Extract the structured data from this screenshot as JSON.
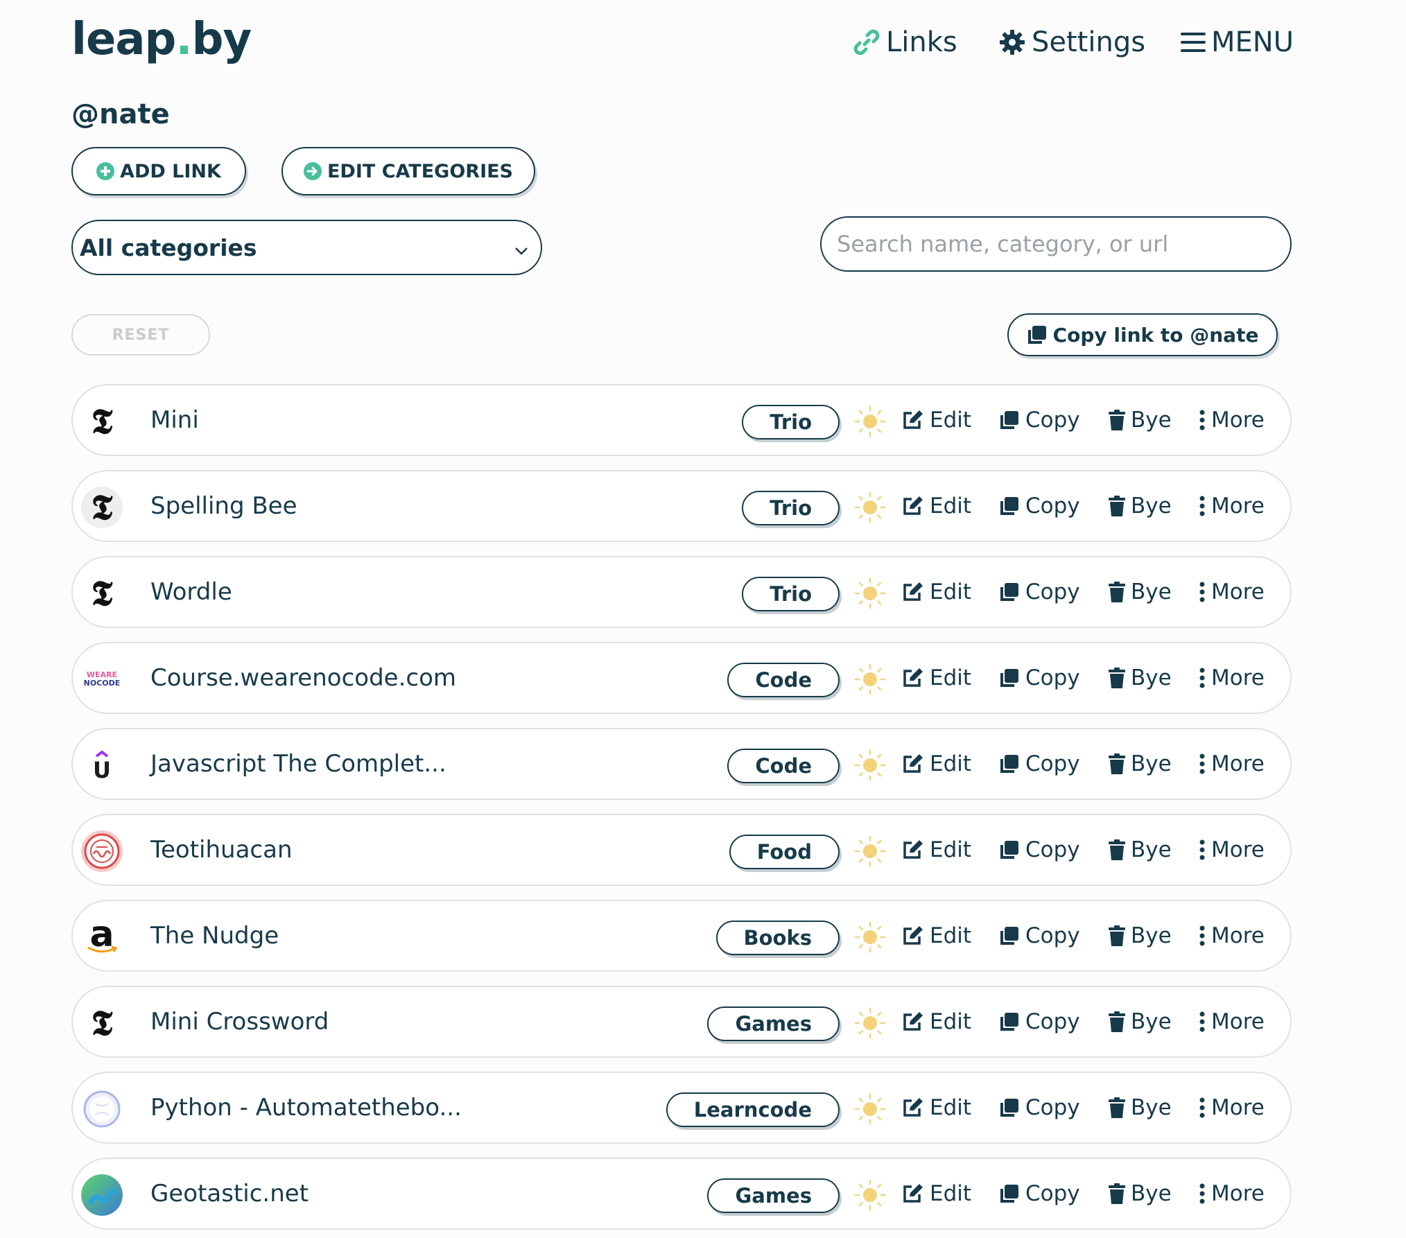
{
  "header": {
    "logo_part1": "leap",
    "logo_dot": ".",
    "logo_part2": "by",
    "nav": {
      "links": "Links",
      "settings": "Settings",
      "menu": "MENU"
    }
  },
  "profile": {
    "username": "@nate"
  },
  "toolbar": {
    "add_link": "ADD LINK",
    "edit_categories": "EDIT CATEGORIES",
    "category_select": "All categories",
    "search_placeholder": "Search name, category, or url",
    "reset": "RESET",
    "copy_link": "Copy link to @nate"
  },
  "actions": {
    "edit": "Edit",
    "copy": "Copy",
    "bye": "Bye",
    "more": "More"
  },
  "links": [
    {
      "name": "Mini",
      "category": "Trio",
      "icon": "nyt-icon"
    },
    {
      "name": "Spelling Bee",
      "category": "Trio",
      "icon": "nyt-icon"
    },
    {
      "name": "Wordle",
      "category": "Trio",
      "icon": "nyt-icon"
    },
    {
      "name": "Course.wearenocode.com",
      "category": "Code",
      "icon": "wearenocode-icon",
      "icon_text_1": "WEARE",
      "icon_text_2": "NOCODE"
    },
    {
      "name": "Javascript The Complet...",
      "category": "Code",
      "icon": "udemy-icon",
      "icon_text_1": "U"
    },
    {
      "name": "Teotihuacan",
      "category": "Food",
      "icon": "teotihuacan-icon"
    },
    {
      "name": "The Nudge",
      "category": "Books",
      "icon": "amazon-icon",
      "icon_text_1": "a"
    },
    {
      "name": "Mini Crossword",
      "category": "Games",
      "icon": "nyt-icon"
    },
    {
      "name": "Python - Automatethebo...",
      "category": "Learncode",
      "icon": "globe-icon"
    },
    {
      "name": "Geotastic.net",
      "category": "Games",
      "icon": "geotastic-icon"
    }
  ],
  "colors": {
    "primary": "#173a4a",
    "accent": "#48bf9c",
    "sun": "#f3d27a",
    "border": "#dfe2e4"
  }
}
